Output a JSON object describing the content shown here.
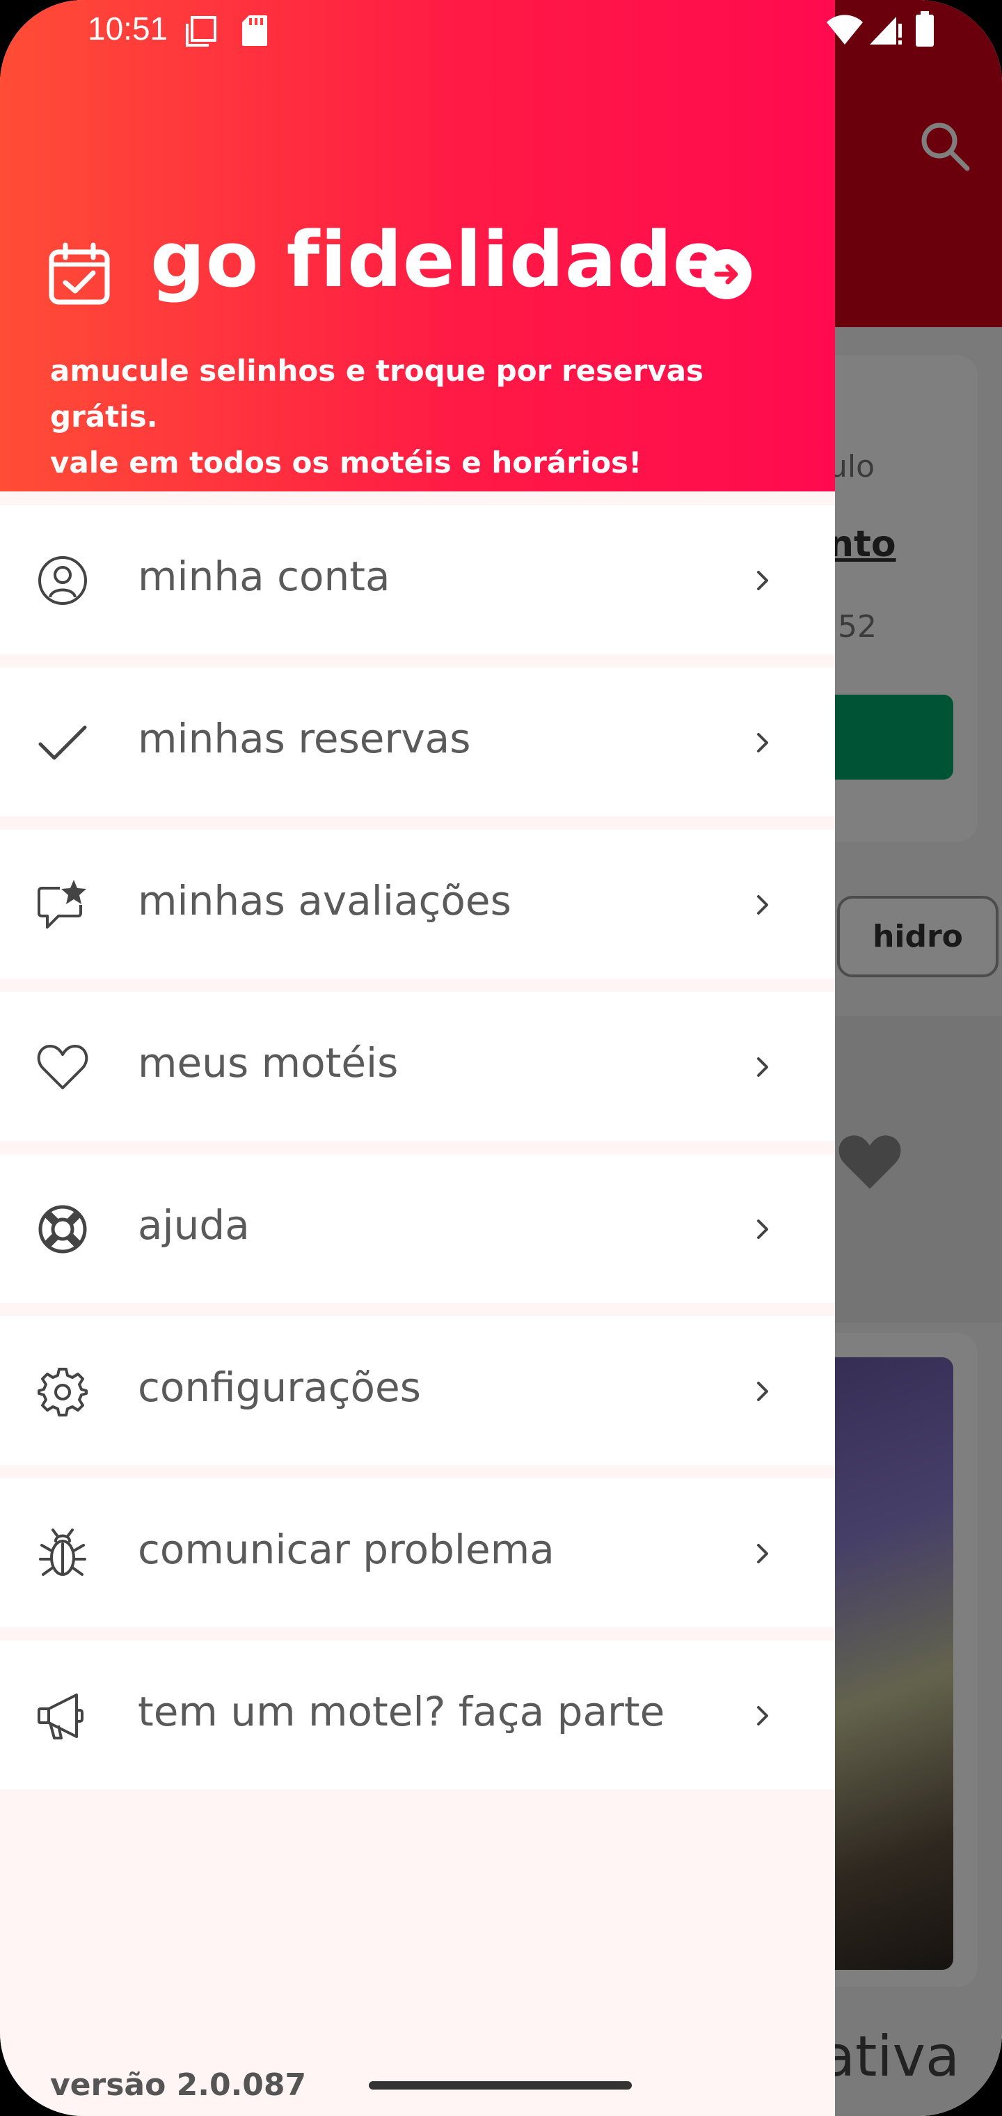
{
  "status_bar": {
    "time": "10:51",
    "icons": [
      "window-icon",
      "sd-card-icon",
      "wifi-icon",
      "signal-icon",
      "battery-icon"
    ]
  },
  "background": {
    "partial_text_1": "ulo",
    "partial_text_2": "nto",
    "partial_text_3": ",52",
    "chip_label": "hidro",
    "partial_text_4": "ativa"
  },
  "drawer": {
    "loyalty": {
      "title": "go fidelidade",
      "subtitle_line1": "amucule selinhos e troque por reservas grátis.",
      "subtitle_line2": "vale em todos os motéis e horários!",
      "icon": "calendar-check-icon",
      "action_icon": "arrow-right-circle-icon"
    },
    "menu": [
      {
        "label": "minha conta",
        "icon": "user-circle-icon"
      },
      {
        "label": "minhas reservas",
        "icon": "check-icon"
      },
      {
        "label": "minhas avaliações",
        "icon": "star-comment-icon"
      },
      {
        "label": "meus motéis",
        "icon": "heart-icon"
      },
      {
        "label": "ajuda",
        "icon": "lifebuoy-icon"
      },
      {
        "label": "configurações",
        "icon": "gear-icon"
      },
      {
        "label": "comunicar problema",
        "icon": "bug-icon"
      },
      {
        "label": "tem um motel? faça parte",
        "icon": "megaphone-icon"
      }
    ],
    "version": "versão 2.0.087"
  },
  "colors": {
    "header_gradient_start": "#ff4d36",
    "header_gradient_end": "#ff0a4f",
    "drawer_background": "#fff5f4",
    "menu_text": "#5a5a5a",
    "icon_stroke": "#444444"
  }
}
